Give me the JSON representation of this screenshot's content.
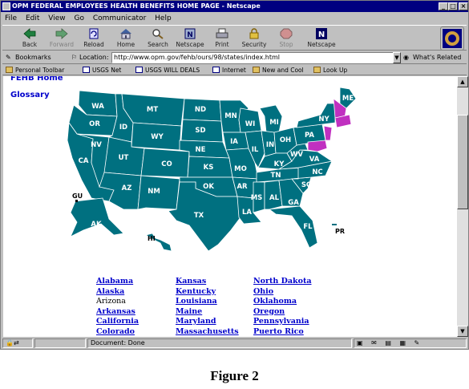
{
  "window": {
    "title": "OPM FEDERAL EMPLOYEES HEALTH BENEFITS HOME PAGE - Netscape"
  },
  "menu": [
    "File",
    "Edit",
    "View",
    "Go",
    "Communicator",
    "Help"
  ],
  "toolbar": [
    {
      "label": "Back",
      "icon": "back-arrow-icon"
    },
    {
      "label": "Forward",
      "icon": "forward-arrow-icon"
    },
    {
      "label": "Reload",
      "icon": "reload-icon"
    },
    {
      "label": "Home",
      "icon": "home-icon"
    },
    {
      "label": "Search",
      "icon": "search-icon"
    },
    {
      "label": "Netscape",
      "icon": "netscape-icon"
    },
    {
      "label": "Print",
      "icon": "print-icon"
    },
    {
      "label": "Security",
      "icon": "security-lock-icon"
    },
    {
      "label": "Stop",
      "icon": "stop-icon"
    },
    {
      "label": "Netscape",
      "icon": "netscape-n-icon"
    }
  ],
  "location": {
    "bookmarks_label": "Bookmarks",
    "location_label": "Location:",
    "url": "http://www.opm.gov/fehb/ours/98/states/index.html",
    "related_label": "What's Related"
  },
  "personal_toolbar": [
    "Personal Toolbar",
    "USGS Net",
    "USGS WILL DEALS",
    "Internet",
    "New and Cool",
    "Look Up"
  ],
  "links": {
    "home": "FEHB Home",
    "glossary": "Glossary"
  },
  "map": {
    "states": [
      "WA",
      "OR",
      "ID",
      "MT",
      "ND",
      "SD",
      "MN",
      "WI",
      "MI",
      "NY",
      "ME",
      "CA",
      "NV",
      "UT",
      "WY",
      "CO",
      "NE",
      "KS",
      "IA",
      "IL",
      "IN",
      "OH",
      "PA",
      "AZ",
      "NM",
      "OK",
      "MO",
      "KY",
      "WV",
      "VA",
      "TX",
      "AR",
      "TN",
      "NC",
      "SC",
      "MS",
      "AL",
      "GA",
      "LA",
      "FL",
      "AK",
      "HI"
    ],
    "territories": [
      "GU",
      "PR"
    ],
    "colors": {
      "state_fill": "#007080",
      "highlight": "#c030c0",
      "border": "#ffffff"
    }
  },
  "state_links": [
    [
      "Alabama",
      "Alaska",
      "Arizona",
      "Arkansas",
      "California",
      "Colorado"
    ],
    [
      "Kansas",
      "Kentucky",
      "Louisiana",
      "Maine",
      "Maryland",
      "Massachusetts"
    ],
    [
      "North Dakota",
      "Ohio",
      "Oklahoma",
      "Oregon",
      "Pennsylvania",
      "Puerto Rico"
    ]
  ],
  "plain_links": [
    "Arizona"
  ],
  "status": {
    "text": "Document: Done"
  },
  "caption": "Figure 2"
}
